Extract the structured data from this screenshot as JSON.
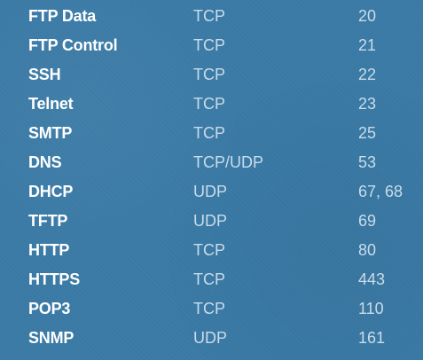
{
  "colors": {
    "background": "#3a7aa6",
    "service_text": "#ffffff",
    "value_text": "#c9dcea"
  },
  "rows": [
    {
      "service": "FTP Data",
      "protocol": "TCP",
      "port": "20"
    },
    {
      "service": "FTP Control",
      "protocol": "TCP",
      "port": "21"
    },
    {
      "service": "SSH",
      "protocol": "TCP",
      "port": "22"
    },
    {
      "service": "Telnet",
      "protocol": "TCP",
      "port": "23"
    },
    {
      "service": "SMTP",
      "protocol": "TCP",
      "port": "25"
    },
    {
      "service": "DNS",
      "protocol": "TCP/UDP",
      "port": "53"
    },
    {
      "service": "DHCP",
      "protocol": "UDP",
      "port": "67, 68"
    },
    {
      "service": "TFTP",
      "protocol": "UDP",
      "port": "69"
    },
    {
      "service": "HTTP",
      "protocol": "TCP",
      "port": "80"
    },
    {
      "service": "HTTPS",
      "protocol": "TCP",
      "port": "443"
    },
    {
      "service": "POP3",
      "protocol": "TCP",
      "port": "110"
    },
    {
      "service": "SNMP",
      "protocol": "UDP",
      "port": "161"
    }
  ]
}
